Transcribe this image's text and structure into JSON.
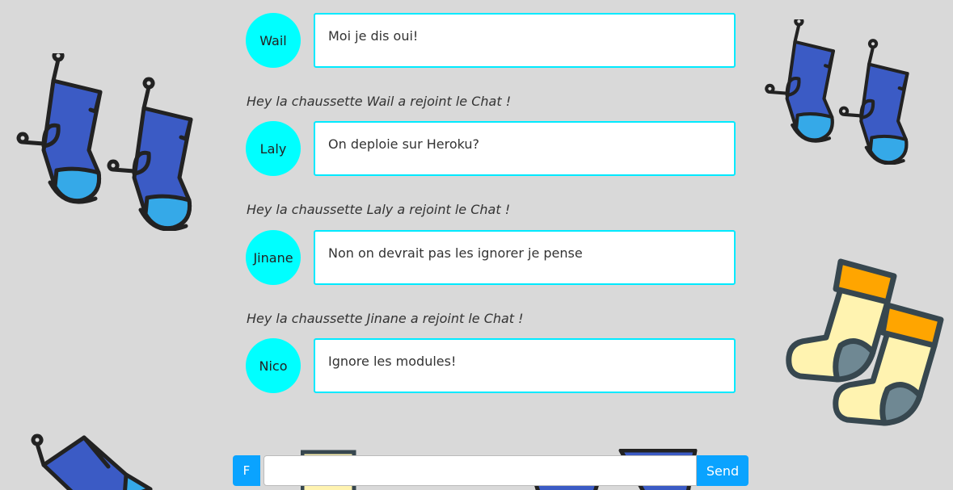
{
  "messages": [
    {
      "author": "Wail",
      "text": "Moi je dis oui!"
    },
    {
      "author": "Laly",
      "text": "On deploie sur Heroku?"
    },
    {
      "author": "Jinane",
      "text": "Non on devrait pas les ignorer je pense"
    },
    {
      "author": "Nico",
      "text": "Ignore les modules!"
    }
  ],
  "notices": [
    "Hey la chaussette Wail a rejoint le Chat !",
    "Hey la chaussette Laly a rejoint le Chat !",
    "Hey la chaussette Jinane a rejoint le Chat !"
  ],
  "composer": {
    "f_label": "F",
    "input_value": "",
    "send_label": "Send"
  },
  "colors": {
    "background": "#d9d9d9",
    "avatar": "#00ffff",
    "bubble_border": "#00eaff",
    "button": "#0aa3ff",
    "sock_blue": "#3b5bc5",
    "sock_light_blue": "#35a9e8",
    "sock_yellow": "#fff3b0",
    "sock_orange": "#ffa500",
    "sock_grey": "#6f8893"
  },
  "decorations": [
    "blue-socks-icon",
    "yellow-socks-icon"
  ]
}
